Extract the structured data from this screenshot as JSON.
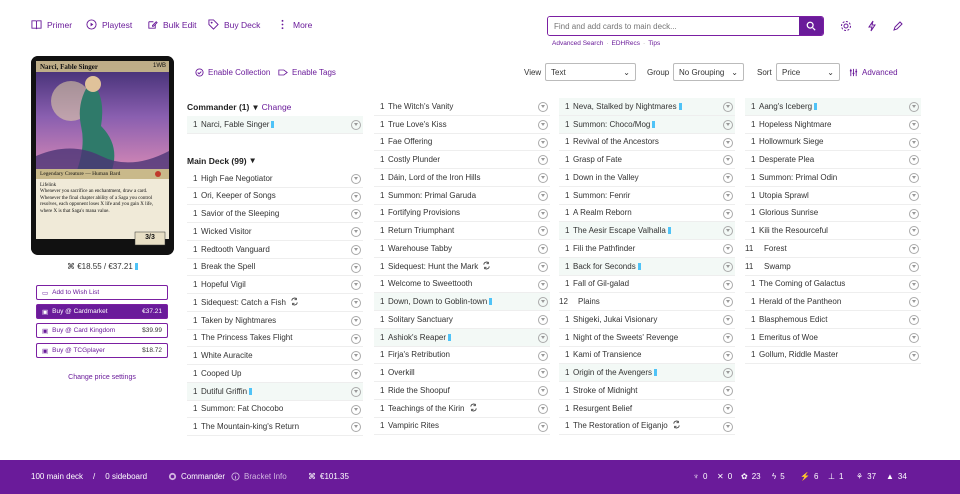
{
  "toolbar": {
    "primer": "Primer",
    "playtest": "Playtest",
    "bulk_edit": "Bulk Edit",
    "buy_deck": "Buy Deck",
    "more": "More"
  },
  "search": {
    "placeholder": "Find and add cards to main deck...",
    "advanced": "Advanced Search",
    "edhrecs": "EDHRecs",
    "tips": "Tips",
    "sep": "·"
  },
  "card_preview": {
    "name": "Narci, Fable Singer",
    "mana": "1WB",
    "type_line": "Legendary Creature — Human Bard",
    "rules": [
      "Lifelink",
      "Whenever you sacrifice an enchantment, draw a card.",
      "Whenever the final chapter ability of a Saga you control resolves, each opponent loses X life and you gain X life, where X is that Saga's mana value."
    ],
    "pt": "3/3"
  },
  "prices": {
    "summary": "€18.55 / €37.21",
    "wishlist": "Add to Wish List",
    "buttons": [
      {
        "label": "Buy @ Cardmarket",
        "price": "€37.21"
      },
      {
        "label": "Buy @ Card Kingdom",
        "price": "$39.99"
      },
      {
        "label": "Buy @ TCGplayer",
        "price": "$18.72"
      }
    ],
    "settings": "Change price settings"
  },
  "controls": {
    "enable_collection": "Enable Collection",
    "enable_tags": "Enable Tags",
    "view_label": "View",
    "view_value": "Text",
    "group_label": "Group",
    "group_value": "No Grouping",
    "sort_label": "Sort",
    "sort_value": "Price",
    "advanced": "Advanced"
  },
  "commander": {
    "header": "Commander (1)",
    "change": "Change",
    "cards": [
      {
        "qty": "1",
        "name": "Narci, Fable Singer",
        "tag": true
      }
    ]
  },
  "main_header": "Main Deck (99)",
  "col1": [
    {
      "qty": "1",
      "name": "High Fae Negotiator"
    },
    {
      "qty": "1",
      "name": "Ori, Keeper of Songs"
    },
    {
      "qty": "1",
      "name": "Savior of the Sleeping"
    },
    {
      "qty": "1",
      "name": "Wicked Visitor"
    },
    {
      "qty": "1",
      "name": "Redtooth Vanguard"
    },
    {
      "qty": "1",
      "name": "Break the Spell"
    },
    {
      "qty": "1",
      "name": "Hopeful Vigil"
    },
    {
      "qty": "1",
      "name": "Sidequest: Catch a Fish",
      "swap": true
    },
    {
      "qty": "1",
      "name": "Taken by Nightmares"
    },
    {
      "qty": "1",
      "name": "The Princess Takes Flight"
    },
    {
      "qty": "1",
      "name": "White Auracite"
    },
    {
      "qty": "1",
      "name": "Cooped Up"
    },
    {
      "qty": "1",
      "name": "Dutiful Griffin",
      "tag": true,
      "hl": true
    },
    {
      "qty": "1",
      "name": "Summon: Fat Chocobo"
    },
    {
      "qty": "1",
      "name": "The Mountain-king's Return"
    }
  ],
  "col2": [
    {
      "qty": "1",
      "name": "The Witch's Vanity"
    },
    {
      "qty": "1",
      "name": "True Love's Kiss"
    },
    {
      "qty": "1",
      "name": "Fae Offering"
    },
    {
      "qty": "1",
      "name": "Costly Plunder"
    },
    {
      "qty": "1",
      "name": "Dáin, Lord of the Iron Hills"
    },
    {
      "qty": "1",
      "name": "Summon: Primal Garuda"
    },
    {
      "qty": "1",
      "name": "Fortifying Provisions"
    },
    {
      "qty": "1",
      "name": "Return Triumphant"
    },
    {
      "qty": "1",
      "name": "Warehouse Tabby"
    },
    {
      "qty": "1",
      "name": "Sidequest: Hunt the Mark",
      "swap": true
    },
    {
      "qty": "1",
      "name": "Welcome to Sweettooth"
    },
    {
      "qty": "1",
      "name": "Down, Down to Goblin-town",
      "tag": true,
      "hl": true
    },
    {
      "qty": "1",
      "name": "Solitary Sanctuary"
    },
    {
      "qty": "1",
      "name": "Ashiok's Reaper",
      "tag": true,
      "hl": true
    },
    {
      "qty": "1",
      "name": "Firja's Retribution"
    },
    {
      "qty": "1",
      "name": "Overkill"
    },
    {
      "qty": "1",
      "name": "Ride the Shoopuf"
    },
    {
      "qty": "1",
      "name": "Teachings of the Kirin",
      "swap": true
    },
    {
      "qty": "1",
      "name": "Vampiric Rites"
    }
  ],
  "col3": [
    {
      "qty": "1",
      "name": "Neva, Stalked by Nightmares",
      "tag": true,
      "hl": true
    },
    {
      "qty": "1",
      "name": "Summon: Choco/Mog",
      "tag": true,
      "hl": true
    },
    {
      "qty": "1",
      "name": "Revival of the Ancestors"
    },
    {
      "qty": "1",
      "name": "Grasp of Fate"
    },
    {
      "qty": "1",
      "name": "Down in the Valley"
    },
    {
      "qty": "1",
      "name": "Summon: Fenrir"
    },
    {
      "qty": "1",
      "name": "A Realm Reborn"
    },
    {
      "qty": "1",
      "name": "The Aesir Escape Valhalla",
      "tag": true,
      "hl": true
    },
    {
      "qty": "1",
      "name": "Fili the Pathfinder"
    },
    {
      "qty": "1",
      "name": "Back for Seconds",
      "tag": true,
      "hl": true
    },
    {
      "qty": "1",
      "name": "Fall of Gil-galad"
    },
    {
      "qty": "12",
      "name": "Plains"
    },
    {
      "qty": "1",
      "name": "Shigeki, Jukai Visionary"
    },
    {
      "qty": "1",
      "name": "Night of the Sweets' Revenge"
    },
    {
      "qty": "1",
      "name": "Kami of Transience"
    },
    {
      "qty": "1",
      "name": "Origin of the Avengers",
      "tag": true,
      "hl": true
    },
    {
      "qty": "1",
      "name": "Stroke of Midnight"
    },
    {
      "qty": "1",
      "name": "Resurgent Belief"
    },
    {
      "qty": "1",
      "name": "The Restoration of Eiganjo",
      "swap": true
    }
  ],
  "col4": [
    {
      "qty": "1",
      "name": "Aang's Iceberg",
      "tag": true,
      "hl": true
    },
    {
      "qty": "1",
      "name": "Hopeless Nightmare"
    },
    {
      "qty": "1",
      "name": "Hollowmurk Siege"
    },
    {
      "qty": "1",
      "name": "Desperate Plea"
    },
    {
      "qty": "1",
      "name": "Summon: Primal Odin"
    },
    {
      "qty": "1",
      "name": "Utopia Sprawl"
    },
    {
      "qty": "1",
      "name": "Glorious Sunrise"
    },
    {
      "qty": "1",
      "name": "Kili the Resourceful"
    },
    {
      "qty": "11",
      "name": "Forest"
    },
    {
      "qty": "11",
      "name": "Swamp"
    },
    {
      "qty": "1",
      "name": "The Coming of Galactus"
    },
    {
      "qty": "1",
      "name": "Herald of the Pantheon"
    },
    {
      "qty": "1",
      "name": "Blasphemous Edict"
    },
    {
      "qty": "1",
      "name": "Emeritus of Woe"
    },
    {
      "qty": "1",
      "name": "Gollum, Riddle Master"
    }
  ],
  "footer": {
    "main_count": "100 main deck",
    "slash": "/",
    "side_count": "0 sideboard",
    "commander": "Commander",
    "bracket": "Bracket Info",
    "price": "€101.35",
    "stats": [
      "0",
      "0",
      "23",
      "5",
      "6",
      "1",
      "37",
      "34"
    ]
  },
  "colors": {
    "accent": "#6a1b9a",
    "tag": "#4fc3f7",
    "highlight_row": "#f3f9f6"
  }
}
